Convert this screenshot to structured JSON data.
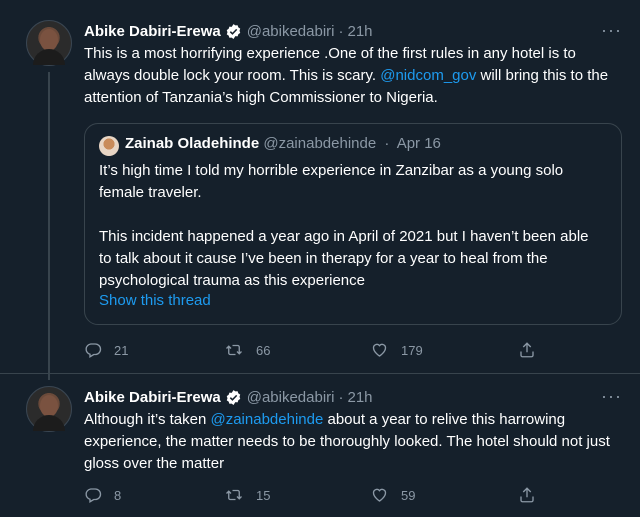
{
  "tweets": [
    {
      "author_name": "Abike Dabiri-Erewa",
      "handle": "@abikedabiri",
      "time": "21h",
      "text_parts": [
        "This is a most horrifying experience .One of the first rules in any hotel is to always double lock your room. This is scary. ",
        "@nidcom_gov",
        " will bring this to the attention of Tanzania’s high Commissioner to Nigeria."
      ],
      "quote": {
        "author_name": "Zainab Oladehinde",
        "handle": "@zainabdehinde",
        "date": "Apr 16",
        "para1": "It’s high time I told my horrible experience in Zanzibar as a young solo female traveler.",
        "para2": "This incident happened a year ago in April of 2021 but I haven’t been able to talk about it cause I’ve been in therapy for a year to heal from the psychological trauma as this experience",
        "show_thread": "Show this thread"
      },
      "replies": "21",
      "retweets": "66",
      "likes": "179"
    },
    {
      "author_name": "Abike Dabiri-Erewa",
      "handle": "@abikedabiri",
      "time": "21h",
      "text_parts": [
        "Although it’s taken ",
        "@zainabdehinde",
        " about a year to relive this harrowing experience, the matter needs to be thoroughly looked. The hotel should not just gloss over the matter"
      ],
      "replies": "8",
      "retweets": "15",
      "likes": "59"
    }
  ],
  "ui": {
    "more_label": "···",
    "dot": "·"
  },
  "colors": {
    "background": "#15202b",
    "accent": "#1d9bf0",
    "muted": "#8b98a5",
    "border": "#38444d"
  },
  "icons": [
    "verified-badge-icon",
    "reply-icon",
    "retweet-icon",
    "like-icon",
    "share-icon",
    "more-icon"
  ]
}
